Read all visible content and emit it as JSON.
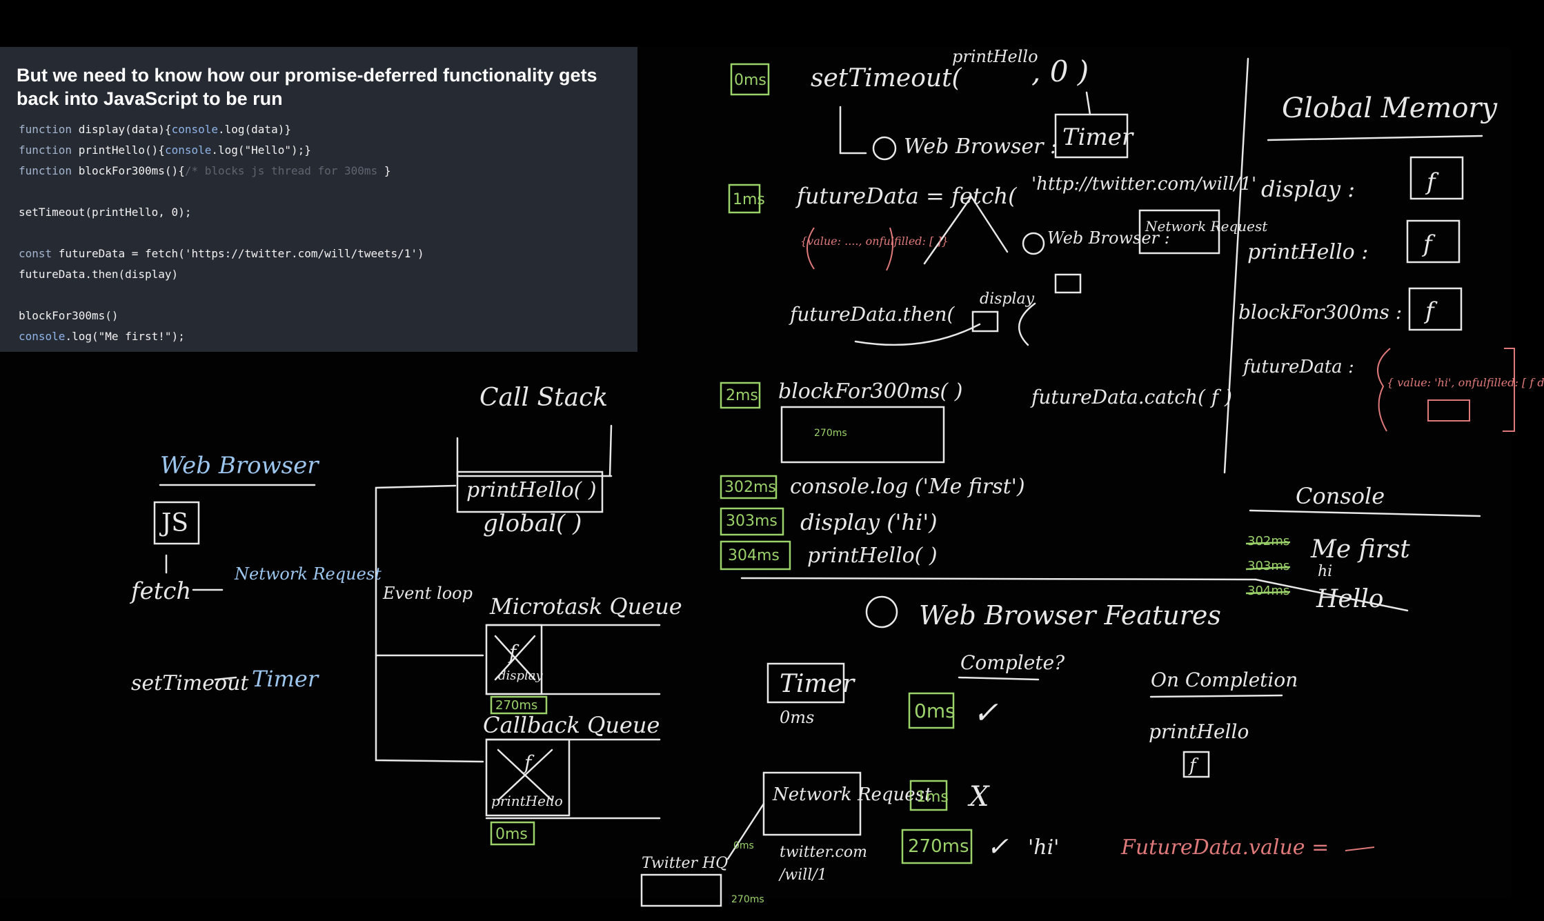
{
  "slide": {
    "title": "But we need to know how our promise-deferred functionality gets back into JavaScript to be run",
    "code": [
      [
        {
          "t": "function ",
          "c": "kw"
        },
        {
          "t": "display(data){",
          "c": "fn"
        },
        {
          "t": "console",
          "c": "cl"
        },
        {
          "t": ".log(data)}",
          "c": "fn"
        }
      ],
      [
        {
          "t": "function ",
          "c": "kw"
        },
        {
          "t": "printHello(){",
          "c": "fn"
        },
        {
          "t": "console",
          "c": "cl"
        },
        {
          "t": ".log(\"Hello\");}",
          "c": "fn"
        }
      ],
      [
        {
          "t": "function ",
          "c": "kw"
        },
        {
          "t": "blockFor300ms(){",
          "c": "fn"
        },
        {
          "t": "/* blocks js thread for 300ms ",
          "c": "cm"
        },
        {
          "t": "}",
          "c": "fn"
        }
      ],
      [],
      [
        {
          "t": "setTimeout(printHello, 0);",
          "c": "fn"
        }
      ],
      [],
      [
        {
          "t": "const ",
          "c": "kw"
        },
        {
          "t": "futureData = fetch('https://twitter.com/will/tweets/1')",
          "c": "fn"
        }
      ],
      [
        {
          "t": "futureData.then(display)",
          "c": "fn"
        }
      ],
      [],
      [
        {
          "t": "blockFor300ms()",
          "c": "fn"
        }
      ],
      [
        {
          "t": "console",
          "c": "cl"
        },
        {
          "t": ".log(\"Me first!\");",
          "c": "fn"
        }
      ]
    ]
  },
  "board": {
    "colors": {
      "chalk": "#e8e8e8",
      "green": "#9bd26a",
      "blue": "#9cc6ee",
      "red": "#e07a7a"
    },
    "left": {
      "web_browser": "Web Browser",
      "js": "JS",
      "fetch": "fetch",
      "network_request": "Network Request",
      "settimeout": "setTimeout",
      "timer": "Timer"
    },
    "call_stack": {
      "title": "Call Stack",
      "frames": [
        "printHello( )",
        "global( )"
      ]
    },
    "event_loop": "Event loop",
    "microtask_queue": {
      "title": "Microtask Queue",
      "item_fn": "f",
      "item_label": "display",
      "time": "270ms"
    },
    "callback_queue": {
      "title": "Callback Queue",
      "item_fn": "f",
      "item_label": "printHello",
      "time": "0ms"
    },
    "timeline": {
      "t0": "0ms",
      "set_timeout": "setTimeout(",
      "print_hello": "printHello",
      "zero": ", 0 )",
      "web_browser": "Web Browser :",
      "timer": "Timer",
      "t1": "1ms",
      "future_data": "futureData  =  fetch(",
      "url": "'http://twitter.com/will/1'",
      "network_request": "Network Request",
      "value_hint": "{value: ...., onfulfilled: [ ]}",
      "then_line": "futureData.then(",
      "display": "display",
      "catch_line": "futureData.catch( f )",
      "t2": "2ms",
      "block": "blockFor300ms( )",
      "t270": "270ms",
      "t302": "302ms",
      "console_log": "console.log ('Me first')",
      "t303": "303ms",
      "display_hi": "display ('hi')",
      "t304": "304ms",
      "print_hello_call": "printHello( )"
    },
    "global_memory": {
      "title": "Global Memory",
      "items": [
        {
          "label": "display :",
          "value": "f"
        },
        {
          "label": "printHello :",
          "value": "f"
        },
        {
          "label": "blockFor300ms :",
          "value": "f"
        },
        {
          "label": "futureData :",
          "value": "{ value: 'hi', onfulfilled: [ f display ] }"
        }
      ]
    },
    "console": {
      "title": "Console",
      "lines": [
        {
          "time": "302ms",
          "text": "Me first"
        },
        {
          "time": "303ms",
          "text": "hi"
        },
        {
          "time": "304ms",
          "text": "Hello"
        }
      ]
    },
    "features": {
      "title": "Web Browser Features",
      "complete": "Complete?",
      "on_completion": "On Completion",
      "timer": "Timer",
      "timer_sub": "0ms",
      "timer_done": "0ms",
      "check": "✓",
      "print_hello": "printHello",
      "f": "f",
      "network_request": "Network Request",
      "twitter": "twitter.com",
      "will": "/will/1",
      "t1": "1ms",
      "x": "X",
      "t270": "270ms",
      "hi": "'hi'",
      "future_value": "FutureData.value =",
      "twitter_hq": "Twitter HQ",
      "t0": "0ms",
      "t270s": "270ms"
    }
  }
}
